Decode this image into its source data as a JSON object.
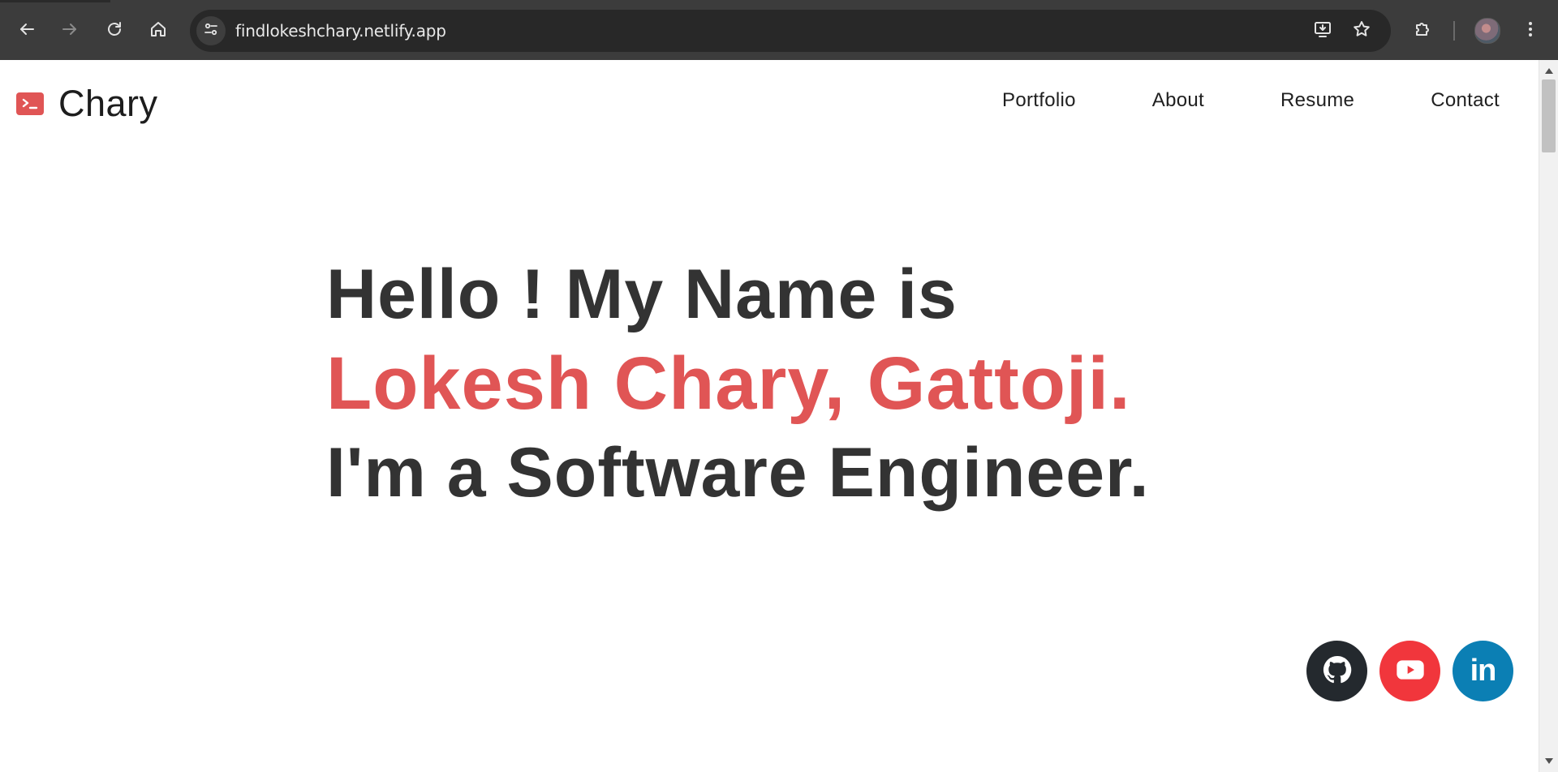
{
  "browser": {
    "url": "findlokeshchary.netlify.app",
    "buttons": {
      "back": "back-icon",
      "forward": "forward-icon",
      "reload": "reload-icon",
      "home": "home-icon",
      "site_info": "tune-icon",
      "install": "install-app-icon",
      "bookmark": "star-icon",
      "extensions": "puzzle-icon",
      "menu": "kebab-menu-icon"
    }
  },
  "site": {
    "brand": {
      "icon": "terminal-icon",
      "name": "Chary"
    },
    "nav": [
      {
        "label": "Portfolio"
      },
      {
        "label": "About"
      },
      {
        "label": "Resume"
      },
      {
        "label": "Contact"
      }
    ],
    "hero": {
      "line1": "Hello ! My Name is",
      "line2": "Lokesh Chary, Gattoji.",
      "line3": "I'm a Software Engineer."
    },
    "social": {
      "github": "github-icon",
      "youtube": "youtube-icon",
      "linkedin_label": "in"
    }
  },
  "colors": {
    "accent": "#e05555",
    "text": "#333333",
    "toolbar": "#3c3c3c",
    "github": "#24292e",
    "youtube": "#f1363c",
    "linkedin": "#0b7fb4"
  }
}
